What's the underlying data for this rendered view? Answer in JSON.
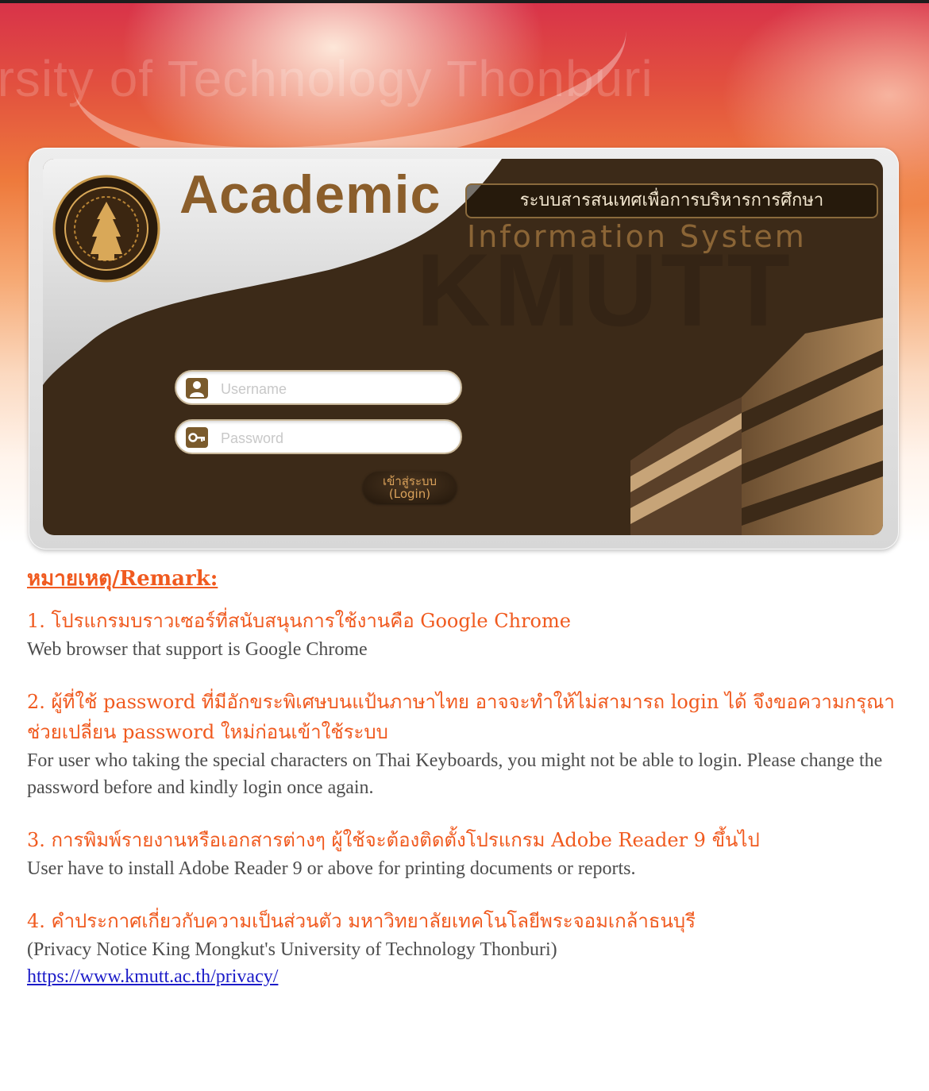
{
  "background": {
    "watermark_text": "ersity of Technology Thonburi"
  },
  "header": {
    "title": "Academic",
    "thai_title": "ระบบสารสนเทศเพื่อการบริหารการศึกษา",
    "subtitle": "Information System",
    "watermark": "KMUTT"
  },
  "login": {
    "username_placeholder": "Username",
    "password_placeholder": "Password",
    "button_line1": "เข้าสู่ระบบ",
    "button_line2": "(Login)"
  },
  "remarks": {
    "heading": "หมายเหตุ/Remark:",
    "items": [
      {
        "thai": "1. โปรแกรมบราวเซอร์ที่สนับสนุนการใช้งานคือ Google Chrome",
        "english": "Web browser that support is Google Chrome"
      },
      {
        "thai": "2. ผู้ที่ใช้ password ที่มีอักขระพิเศษบนแป้นภาษาไทย อาจจะทำให้ไม่สามารถ login ได้ จึงขอความกรุณาช่วยเปลี่ยน password ใหม่ก่อนเข้าใช้ระบบ",
        "english": "For user who taking the special characters on Thai Keyboards, you might not be able to login. Please change the password before and kindly login once again."
      },
      {
        "thai": "3. การพิมพ์รายงานหรือเอกสารต่างๆ ผู้ใช้จะต้องติดตั้งโปรแกรม Adobe Reader 9 ขึ้นไป",
        "english": "User have to install Adobe Reader 9 or above for printing documents or reports."
      },
      {
        "thai": "4. คำประกาศเกี่ยวกับความเป็นส่วนตัว มหาวิทยาลัยเทคโนโลยีพระจอมเกล้าธนบุรี",
        "english": "(Privacy Notice King Mongkut's University of Technology Thonburi)",
        "link": "https://www.kmutt.ac.th/privacy/"
      }
    ]
  },
  "colors": {
    "accent_orange": "#f05a1f",
    "panel_brown": "#3c2a18",
    "title_brown": "#8b5e2b",
    "link_blue": "#1b1bc8"
  }
}
